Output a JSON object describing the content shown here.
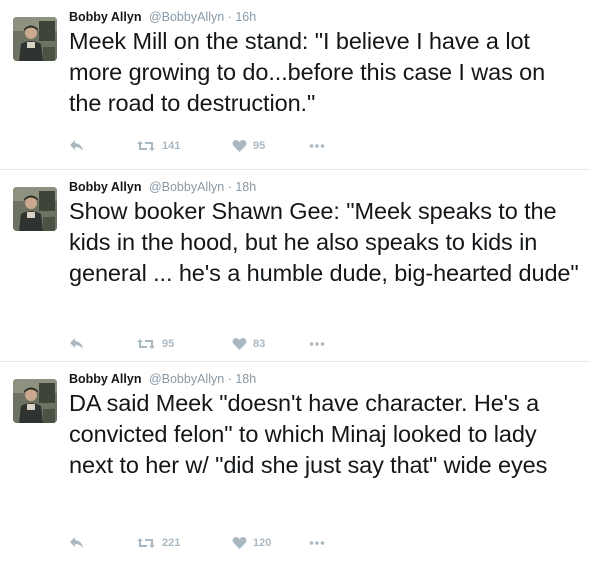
{
  "tweets": [
    {
      "name": "Bobby Allyn",
      "handle": "@BobbyAllyn",
      "separator": "·",
      "time": "16h",
      "text": "Meek Mill on the stand: \"I believe I have a lot more growing to do...before this case I was on the road to destruction.\"",
      "retweets": "141",
      "likes": "95"
    },
    {
      "name": "Bobby Allyn",
      "handle": "@BobbyAllyn",
      "separator": "·",
      "time": "18h",
      "text": "Show booker Shawn Gee: \"Meek speaks to the kids in the hood, but he also speaks to kids in general ... he's a humble dude, big-hearted dude\"",
      "retweets": "95",
      "likes": "83"
    },
    {
      "name": "Bobby Allyn",
      "handle": "@BobbyAllyn",
      "separator": "·",
      "time": "18h",
      "text": "DA said Meek \"doesn't have character. He's a convicted felon\" to which Minaj looked to lady next to her w/ \"did she just say that\" wide eyes",
      "retweets": "221",
      "likes": "120"
    }
  ],
  "icons": {
    "reply": "reply-icon",
    "retweet": "retweet-icon",
    "like": "heart-icon",
    "more": "more-icon"
  },
  "colors": {
    "text": "#14171a",
    "secondary": "#8899a6",
    "action": "#aab8c2",
    "divider": "#e1e8ed"
  }
}
